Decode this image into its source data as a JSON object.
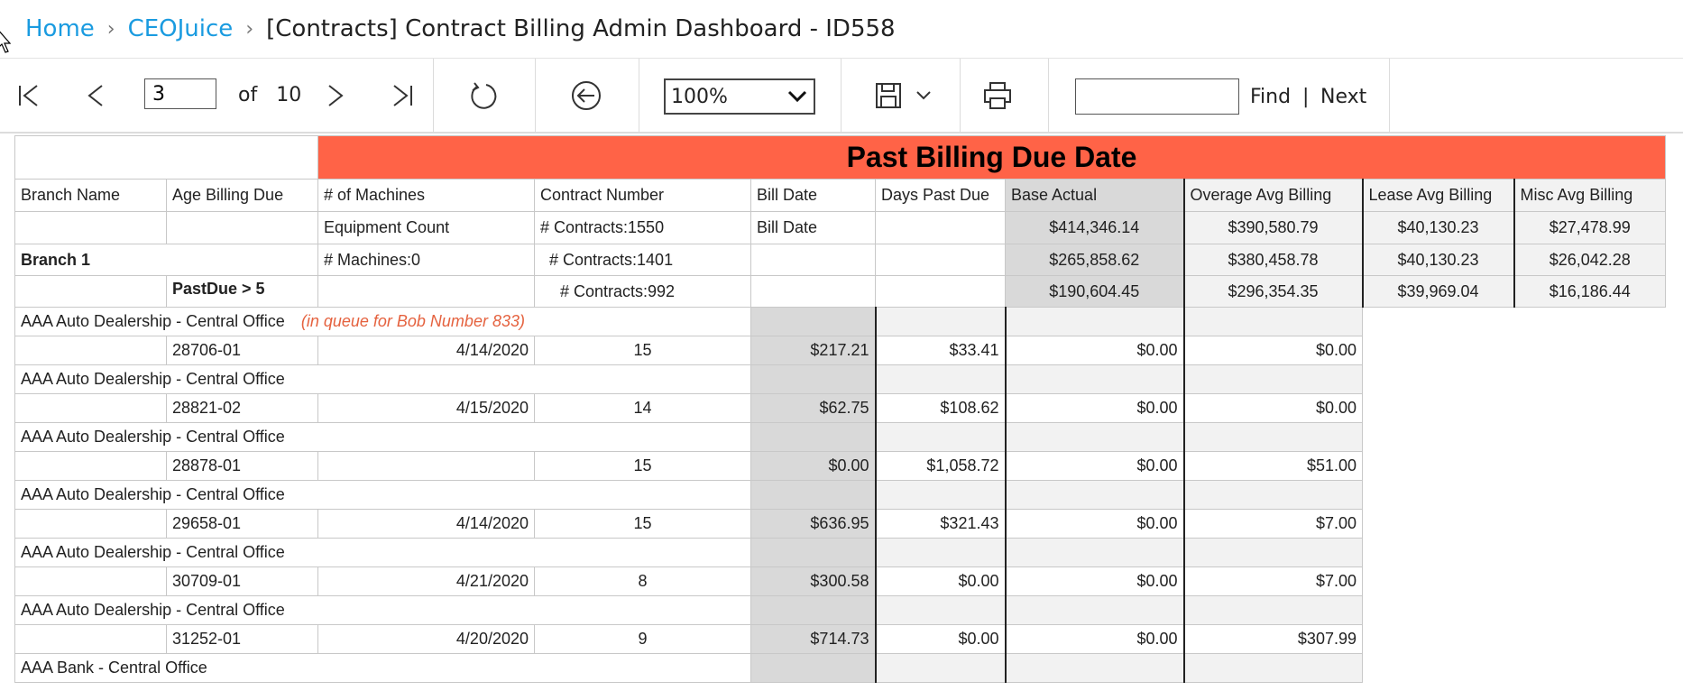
{
  "breadcrumb": {
    "items": [
      "Home",
      "CEOJuice"
    ],
    "current": "[Contracts] Contract Billing Admin Dashboard - ID558"
  },
  "toolbar": {
    "page_value": "3",
    "of_label": "of",
    "total_pages": "10",
    "zoom_value": "100%",
    "find_placeholder": "",
    "find_label": "Find",
    "find_sep": "|",
    "next_label": "Next"
  },
  "report": {
    "title": "Past Billing Due Date",
    "headers": [
      "Branch Name",
      "Age Billing Due",
      "# of Machines",
      "Contract Number",
      "Bill Date",
      "Days Past Due",
      "Base Actual",
      "Overage Avg Billing",
      "Lease Avg Billing",
      "Misc Avg Billing"
    ],
    "summary": {
      "machines": "Equipment Count",
      "contracts": "# Contracts:1550",
      "bill_date": "Bill Date",
      "base": "$414,346.14",
      "overage": "$390,580.79",
      "lease": "$40,130.23",
      "misc": "$27,478.99"
    },
    "branch": {
      "name": "Branch 1",
      "machines": "# Machines:0",
      "contracts": "# Contracts:1401",
      "base": "$265,858.62",
      "overage": "$380,458.78",
      "lease": "$40,130.23",
      "misc": "$26,042.28"
    },
    "age_group": {
      "name": "PastDue > 5",
      "contracts": "# Contracts:992",
      "base": "$190,604.45",
      "overage": "$296,354.35",
      "lease": "$39,969.04",
      "misc": "$16,186.44"
    },
    "entries": [
      {
        "customer": "AAA  Auto Dealership - Central Office",
        "note": "(in queue for Bob Number 833)",
        "contract": "28706-01",
        "bill_date": "4/14/2020",
        "days": "15",
        "base": "$217.21",
        "overage": "$33.41",
        "lease": "$0.00",
        "misc": "$0.00"
      },
      {
        "customer": "AAA  Auto Dealership - Central Office",
        "note": "",
        "contract": "28821-02",
        "bill_date": "4/15/2020",
        "days": "14",
        "base": "$62.75",
        "overage": "$108.62",
        "lease": "$0.00",
        "misc": "$0.00"
      },
      {
        "customer": "AAA  Auto Dealership - Central Office",
        "note": "",
        "contract": "28878-01",
        "bill_date": "",
        "days": "15",
        "base": "$0.00",
        "overage": "$1,058.72",
        "lease": "$0.00",
        "misc": "$51.00"
      },
      {
        "customer": "AAA  Auto Dealership - Central Office",
        "note": "",
        "contract": "29658-01",
        "bill_date": "4/14/2020",
        "days": "15",
        "base": "$636.95",
        "overage": "$321.43",
        "lease": "$0.00",
        "misc": "$7.00"
      },
      {
        "customer": "AAA  Auto Dealership - Central Office",
        "note": "",
        "contract": "30709-01",
        "bill_date": "4/21/2020",
        "days": "8",
        "base": "$300.58",
        "overage": "$0.00",
        "lease": "$0.00",
        "misc": "$7.00"
      },
      {
        "customer": "AAA  Auto Dealership - Central Office",
        "note": "",
        "contract": "31252-01",
        "bill_date": "4/20/2020",
        "days": "9",
        "base": "$714.73",
        "overage": "$0.00",
        "lease": "$0.00",
        "misc": "$307.99"
      }
    ],
    "last_customer": "AAA  Bank - Central Office"
  }
}
